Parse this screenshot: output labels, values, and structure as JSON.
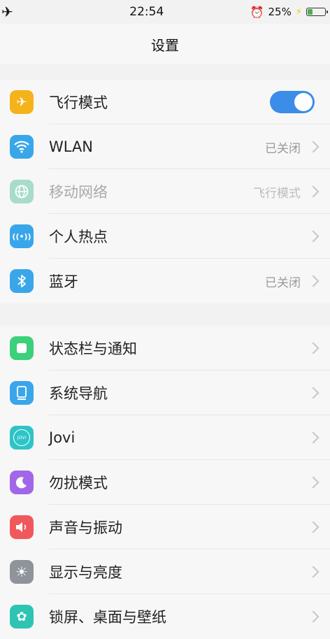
{
  "status": {
    "airplane_glyph": "✈",
    "time": "22:54",
    "alarm_glyph": "⏰",
    "battery_percent_label": "25%",
    "battery_level": 0.25,
    "charging_glyph": "⚡"
  },
  "header": {
    "title": "设置"
  },
  "group1": {
    "airplane": {
      "label": "飞行模式",
      "icon": "airplane-icon",
      "toggle_on": true
    },
    "wlan": {
      "label": "WLAN",
      "value": "已关闭",
      "icon": "wifi-icon"
    },
    "mobile": {
      "label": "移动网络",
      "value": "飞行模式",
      "icon": "globe-icon"
    },
    "hotspot": {
      "label": "个人热点",
      "icon": "hotspot-icon"
    },
    "bluetooth": {
      "label": "蓝牙",
      "value": "已关闭",
      "icon": "bluetooth-icon"
    }
  },
  "group2": {
    "notify": {
      "label": "状态栏与通知",
      "icon": "notification-icon"
    },
    "nav": {
      "label": "系统导航",
      "icon": "navigation-icon"
    },
    "jovi": {
      "label": "Jovi",
      "icon": "jovi-icon",
      "icon_text": "JOVI"
    },
    "dnd": {
      "label": "勿扰模式",
      "icon": "moon-icon"
    },
    "sound": {
      "label": "声音与振动",
      "icon": "speaker-icon"
    },
    "display": {
      "label": "显示与亮度",
      "icon": "brightness-icon"
    },
    "wallpaper": {
      "label": "锁屏、桌面与壁纸",
      "icon": "wallpaper-icon"
    }
  },
  "colors": {
    "toggle_on": "#3b8de8",
    "airplane": "#f6b21b",
    "blue": "#3aa6ea",
    "green": "#3cd07a",
    "purple": "#a167e8",
    "red": "#f0595c",
    "gray": "#8f949b"
  }
}
